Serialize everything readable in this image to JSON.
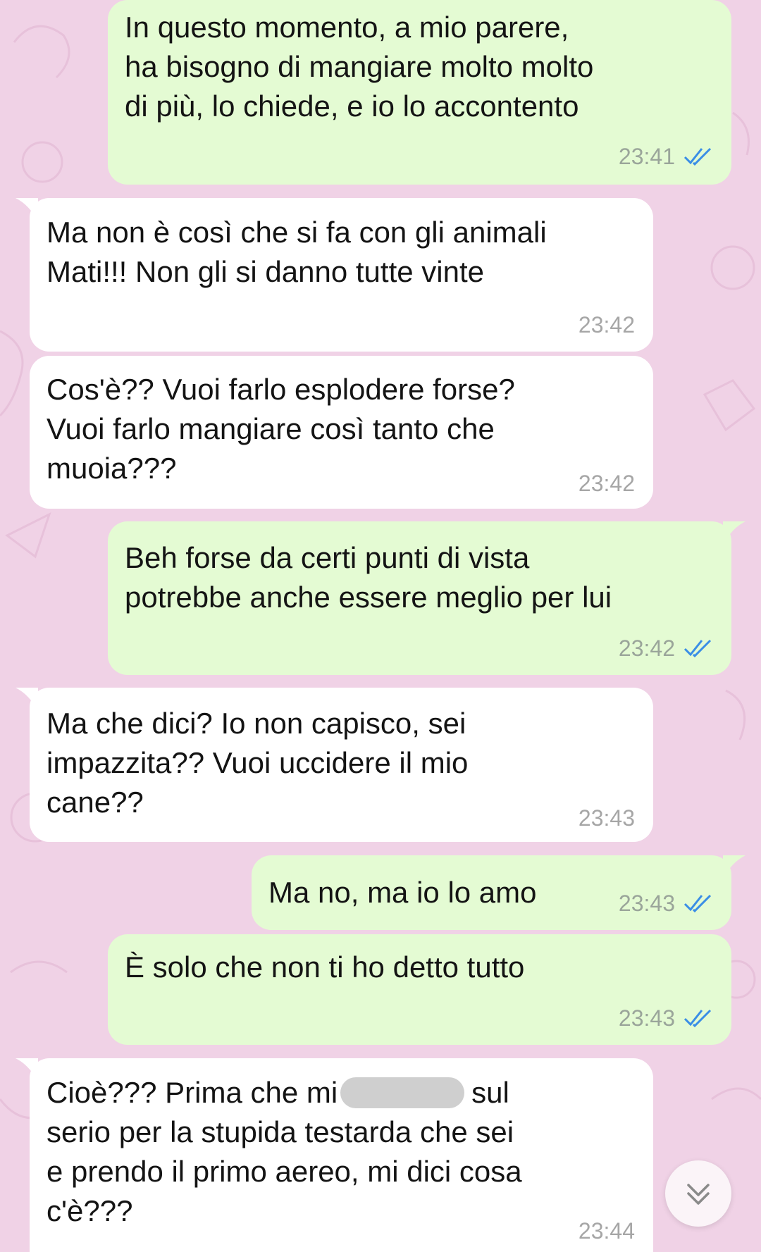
{
  "theme": {
    "background": "#f0d2e6",
    "outgoing_bubble": "#e4fbd3",
    "incoming_bubble": "#ffffff",
    "read_check": "#3a8ee6"
  },
  "messages": [
    {
      "direction": "outgoing",
      "lines": [
        "In questo momento, a mio parere,",
        "ha bisogno di mangiare molto molto",
        "di più, lo chiede, e io lo accontento"
      ],
      "time": "23:41",
      "status": "read-double-check-icon"
    },
    {
      "direction": "incoming",
      "lines": [
        "Ma non è così che si fa con gli animali",
        "Mati!!! Non gli si danno tutte vinte"
      ],
      "time": "23:42"
    },
    {
      "direction": "incoming",
      "lines": [
        "Cos'è?? Vuoi farlo esplodere forse?",
        "Vuoi farlo mangiare così tanto che",
        "muoia???"
      ],
      "time": "23:42"
    },
    {
      "direction": "outgoing",
      "lines": [
        "Beh forse da certi punti di vista",
        "potrebbe anche essere meglio per lui"
      ],
      "time": "23:42",
      "status": "read-double-check-icon"
    },
    {
      "direction": "incoming",
      "lines": [
        "Ma che dici? Io non capisco, sei",
        "impazzita?? Vuoi uccidere il mio",
        "cane??"
      ],
      "time": "23:43"
    },
    {
      "direction": "outgoing",
      "lines": [
        "Ma no, ma io lo amo"
      ],
      "time": "23:43",
      "status": "read-double-check-icon"
    },
    {
      "direction": "outgoing",
      "lines": [
        "È solo che non ti ho detto tutto"
      ],
      "time": "23:43",
      "status": "read-double-check-icon"
    },
    {
      "direction": "incoming",
      "line1_before": "Cioè??? Prima che mi",
      "line1_after": "sul",
      "lines": [
        "serio per la stupida testarda che sei",
        "e prendo il primo aereo, mi dici cosa",
        "c'è???"
      ],
      "time": "23:44"
    }
  ],
  "scroll_button": {
    "icon": "chevron-double-down-icon"
  }
}
